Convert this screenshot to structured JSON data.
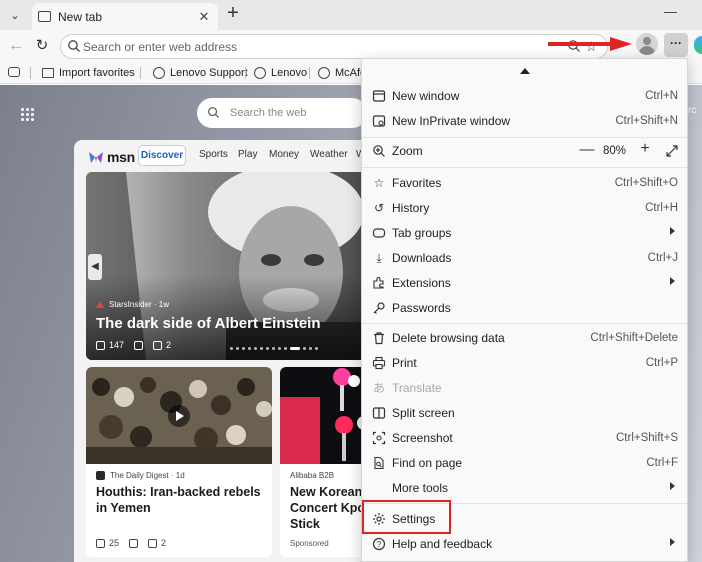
{
  "browser": {
    "tab": {
      "title": "New tab"
    },
    "address_bar": {
      "placeholder": "Search or enter web address"
    },
    "favorites": [
      {
        "label": "Import favorites"
      },
      {
        "label": "Lenovo Support"
      },
      {
        "label": "Lenovo"
      },
      {
        "label": "McAfe"
      }
    ]
  },
  "newtab": {
    "search": {
      "placeholder": "Search the web"
    },
    "right_edge_text": "rc",
    "msn": {
      "logo_text": "msn",
      "tabs": [
        "Discover",
        "Sports",
        "Play",
        "Money",
        "Weather",
        "W"
      ],
      "hero": {
        "source": "StarsInsider · 1w",
        "title": "The dark side of Albert Einstein",
        "likes": "147",
        "comments": "2"
      },
      "cards": [
        {
          "source": "The Daily Digest · 1d",
          "title_lines": [
            "Houthis: Iran-backed rebels",
            "in Yemen"
          ],
          "likes": "25",
          "comments": "2"
        },
        {
          "source": "Alibaba B2B",
          "title_lines": [
            "New Korean",
            "Concert Kpo",
            "Stick"
          ],
          "tag": "Sponsored"
        }
      ]
    }
  },
  "menu": {
    "items": [
      {
        "icon": "new-window-icon",
        "label": "New window",
        "shortcut": "Ctrl+N"
      },
      {
        "icon": "inprivate-icon",
        "label": "New InPrivate window",
        "shortcut": "Ctrl+Shift+N"
      },
      {
        "icon": "zoom-icon",
        "label": "Zoom",
        "zoom_value": "80%"
      },
      {
        "icon": "favorites-icon",
        "label": "Favorites",
        "shortcut": "Ctrl+Shift+O"
      },
      {
        "icon": "history-icon",
        "label": "History",
        "shortcut": "Ctrl+H"
      },
      {
        "icon": "tab-groups-icon",
        "label": "Tab groups"
      },
      {
        "icon": "downloads-icon",
        "label": "Downloads",
        "shortcut": "Ctrl+J"
      },
      {
        "icon": "extensions-icon",
        "label": "Extensions"
      },
      {
        "icon": "passwords-icon",
        "label": "Passwords"
      },
      {
        "icon": "trash-icon",
        "label": "Delete browsing data",
        "shortcut": "Ctrl+Shift+Delete"
      },
      {
        "icon": "print-icon",
        "label": "Print",
        "shortcut": "Ctrl+P"
      },
      {
        "icon": "translate-icon",
        "label": "Translate",
        "disabled": true
      },
      {
        "icon": "split-screen-icon",
        "label": "Split screen"
      },
      {
        "icon": "screenshot-icon",
        "label": "Screenshot",
        "shortcut": "Ctrl+Shift+S"
      },
      {
        "icon": "find-icon",
        "label": "Find on page",
        "shortcut": "Ctrl+F"
      },
      {
        "icon": "more-tools-icon",
        "label": "More tools"
      },
      {
        "icon": "gear-icon",
        "label": "Settings"
      },
      {
        "icon": "help-icon",
        "label": "Help and feedback"
      }
    ]
  },
  "colors": {
    "annotation_red": "#e02424",
    "accent_blue": "#1a5fc4"
  }
}
